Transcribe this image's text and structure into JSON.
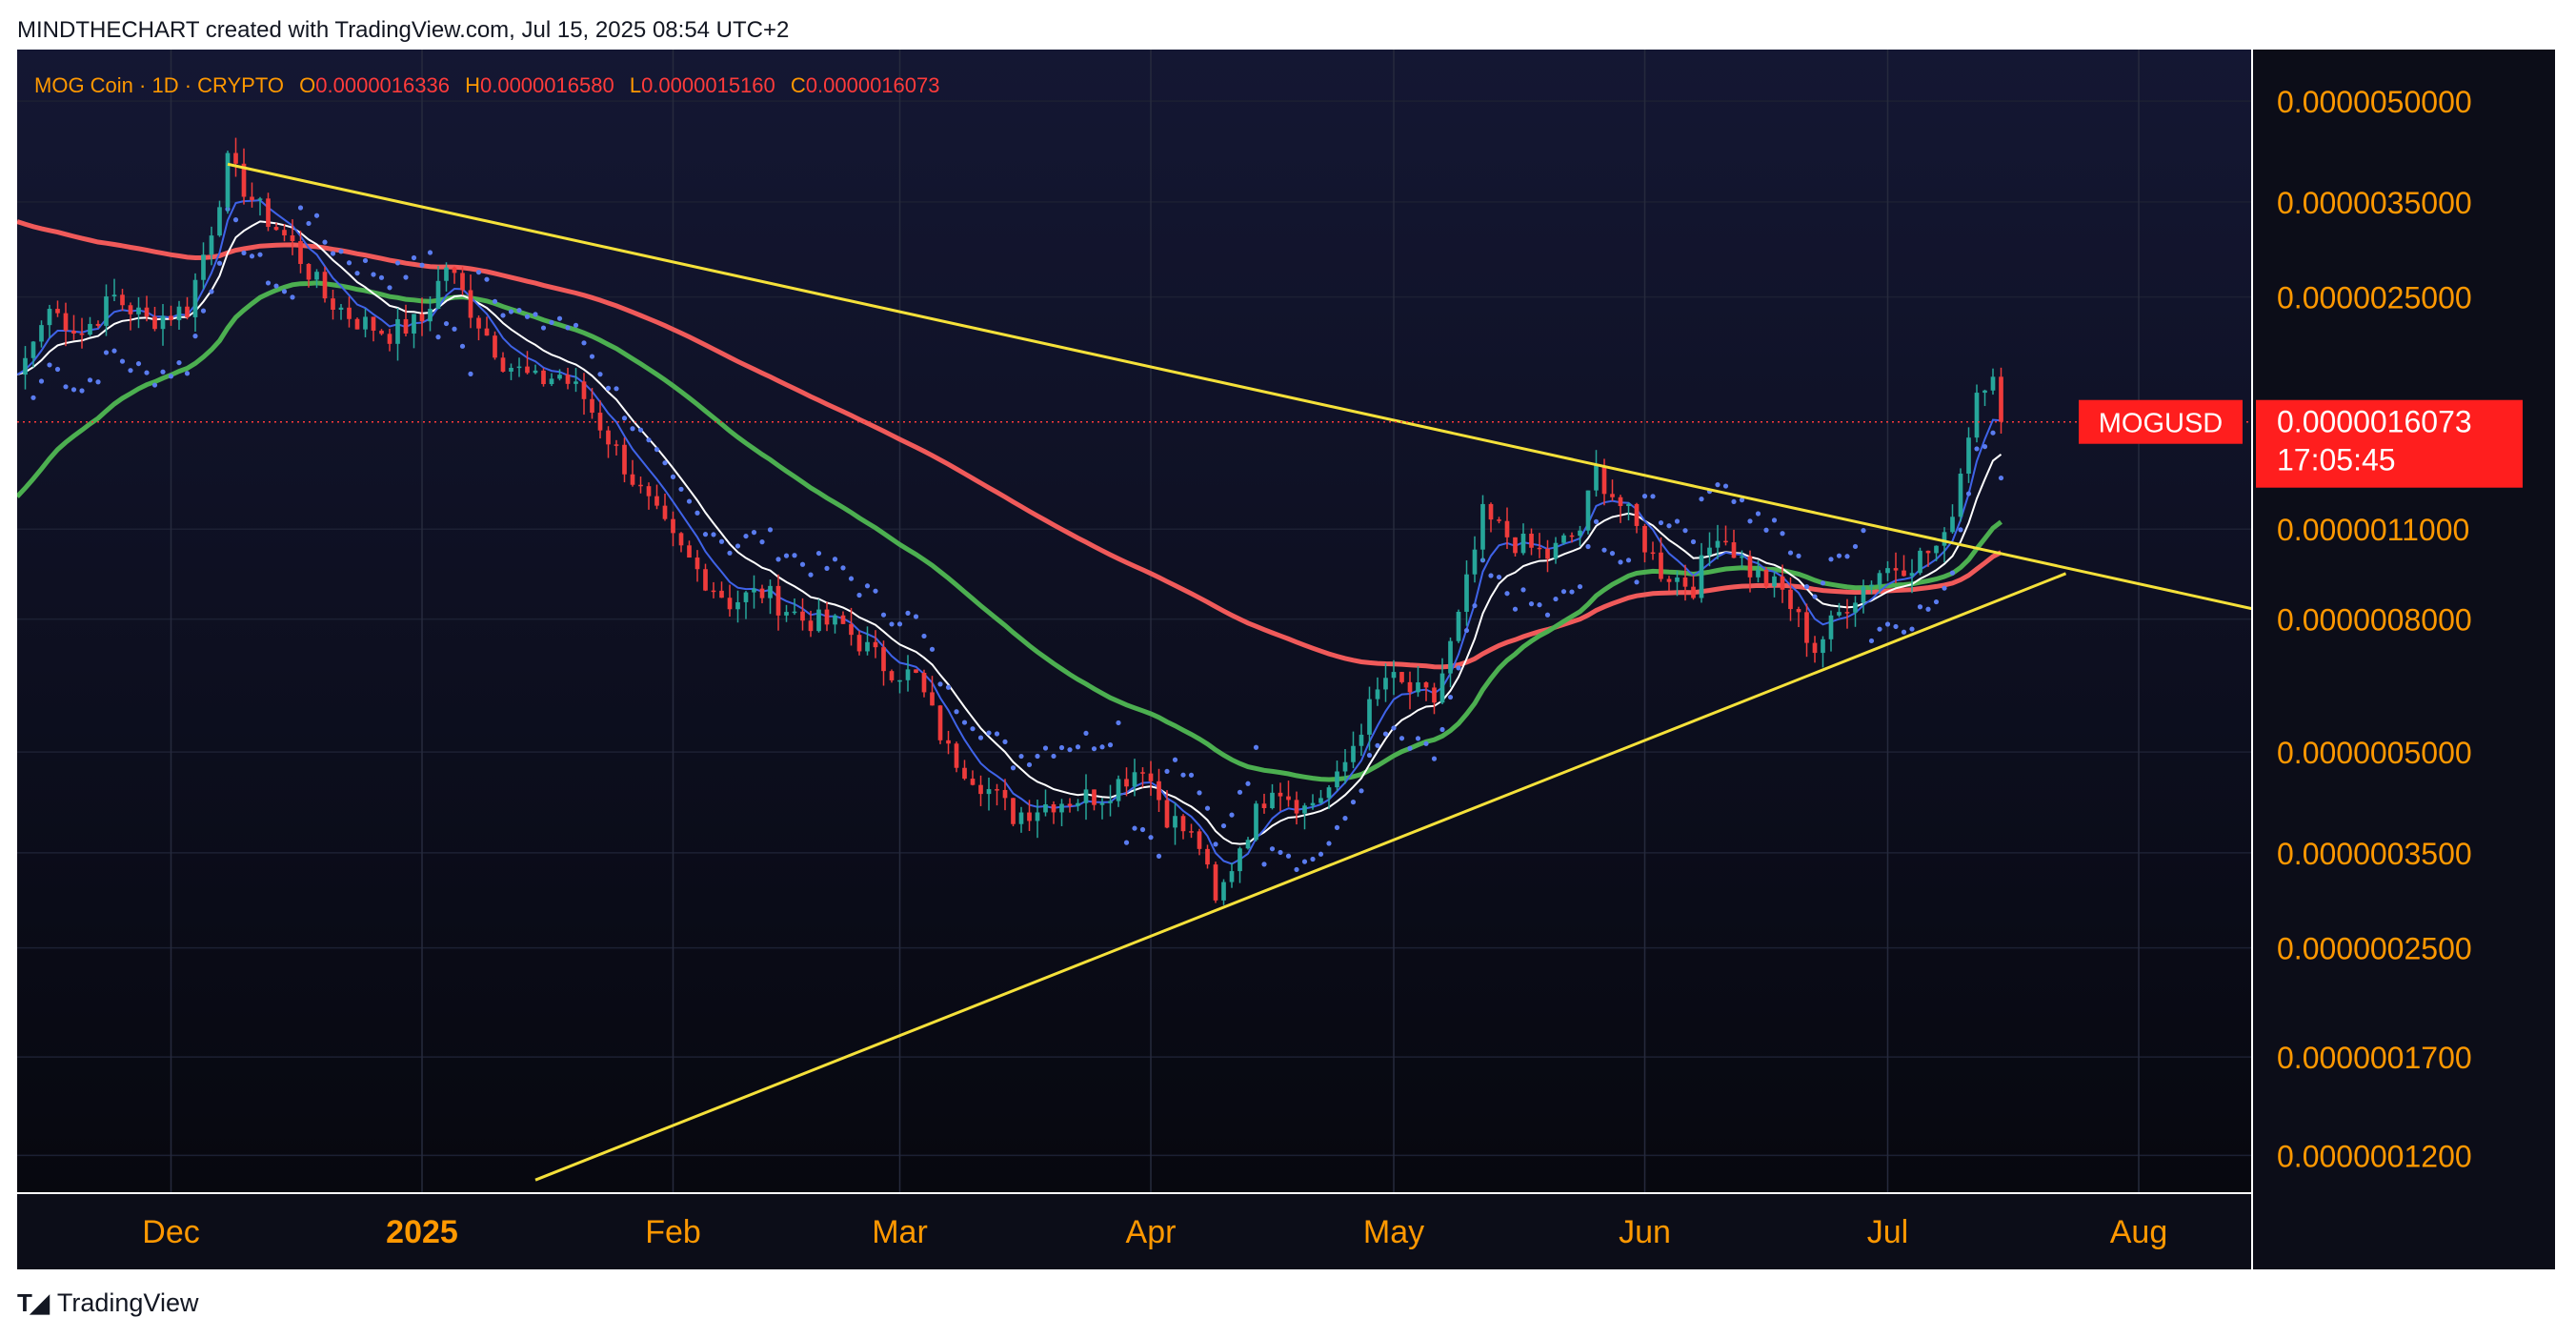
{
  "attribution": "MINDTHECHART created with TradingView.com, Jul 15, 2025 08:54 UTC+2",
  "footer": {
    "logo_text": "TradingView",
    "logo_icon": "tradingview-logo-icon"
  },
  "colors": {
    "background": "#0c0d18",
    "up_candle": "#26a69a",
    "down_candle": "#ef3b3b",
    "ema_long": "#f05a5a",
    "ema_mid": "#4caf50",
    "ma_fast_white": "#ffffff",
    "ma_fast_blue": "#3f63e8",
    "psar_dots": "#5a7cf0",
    "trendline": "#f5e13a",
    "axis_text": "#ff9800",
    "price_label_bg": "#ff1e1e"
  },
  "legend": {
    "symbol": "MOG Coin · 1D · CRYPTO",
    "o_label": "O",
    "o_value": "0.0000016336",
    "h_label": "H",
    "h_value": "0.0000016580",
    "l_label": "L",
    "l_value": "0.0000015160",
    "c_label": "C",
    "c_value": "0.0000016073"
  },
  "price_label": {
    "ticker": "MOGUSD",
    "price": "0.0000016073",
    "countdown": "17:05:45"
  },
  "chart_data": {
    "type": "candlestick",
    "scale": "log",
    "y_ticks": [
      "0.0000050000",
      "0.0000035000",
      "0.0000025000",
      "0.0000011000",
      "0.0000008000",
      "0.0000005000",
      "0.0000003500",
      "0.0000002500",
      "0.0000001700",
      "0.0000001200"
    ],
    "y_tick_values": [
      5e-06,
      3.5e-06,
      2.5e-06,
      1.1e-06,
      8e-07,
      5e-07,
      3.5e-07,
      2.5e-07,
      1.7e-07,
      1.2e-07
    ],
    "x_ticks": [
      "Dec",
      "2025",
      "Feb",
      "Mar",
      "Apr",
      "May",
      "Jun",
      "Jul",
      "Aug"
    ],
    "x_tick_dates": [
      "2024-12-01",
      "2025-01-01",
      "2025-02-01",
      "2025-03-01",
      "2025-04-01",
      "2025-05-01",
      "2025-06-01",
      "2025-07-01",
      "2025-08-01"
    ],
    "x_range": [
      "2024-11-12",
      "2025-08-15"
    ],
    "y_range": [
      1.05e-07,
      6e-06
    ],
    "grid": true,
    "last_close": 1.6073e-06,
    "close_series": [
      {
        "date": "2024-11-12",
        "close": 1.9e-06
      },
      {
        "date": "2024-11-16",
        "close": 2.4e-06
      },
      {
        "date": "2024-11-20",
        "close": 2.2e-06
      },
      {
        "date": "2024-11-24",
        "close": 2.5e-06
      },
      {
        "date": "2024-11-28",
        "close": 2.3e-06
      },
      {
        "date": "2024-12-03",
        "close": 2.4e-06
      },
      {
        "date": "2024-12-06",
        "close": 3.2e-06
      },
      {
        "date": "2024-12-08",
        "close": 4e-06
      },
      {
        "date": "2024-12-12",
        "close": 3.4e-06
      },
      {
        "date": "2024-12-16",
        "close": 3e-06
      },
      {
        "date": "2024-12-20",
        "close": 2.5e-06
      },
      {
        "date": "2024-12-24",
        "close": 2.3e-06
      },
      {
        "date": "2024-12-28",
        "close": 2.2e-06
      },
      {
        "date": "2025-01-01",
        "close": 2.3e-06
      },
      {
        "date": "2025-01-04",
        "close": 2.8e-06
      },
      {
        "date": "2025-01-07",
        "close": 2.4e-06
      },
      {
        "date": "2025-01-11",
        "close": 2e-06
      },
      {
        "date": "2025-01-15",
        "close": 1.85e-06
      },
      {
        "date": "2025-01-18",
        "close": 1.9e-06
      },
      {
        "date": "2025-01-21",
        "close": 1.75e-06
      },
      {
        "date": "2025-01-25",
        "close": 1.45e-06
      },
      {
        "date": "2025-01-28",
        "close": 1.25e-06
      },
      {
        "date": "2025-02-01",
        "close": 1.05e-06
      },
      {
        "date": "2025-02-04",
        "close": 9.5e-07
      },
      {
        "date": "2025-02-08",
        "close": 8.5e-07
      },
      {
        "date": "2025-02-12",
        "close": 8.8e-07
      },
      {
        "date": "2025-02-17",
        "close": 8e-07
      },
      {
        "date": "2025-02-22",
        "close": 7.8e-07
      },
      {
        "date": "2025-02-27",
        "close": 6.8e-07
      },
      {
        "date": "2025-03-03",
        "close": 6.5e-07
      },
      {
        "date": "2025-03-07",
        "close": 5e-07
      },
      {
        "date": "2025-03-11",
        "close": 4.5e-07
      },
      {
        "date": "2025-03-15",
        "close": 4e-07
      },
      {
        "date": "2025-03-20",
        "close": 4.2e-07
      },
      {
        "date": "2025-03-26",
        "close": 4.3e-07
      },
      {
        "date": "2025-03-31",
        "close": 4.8e-07
      },
      {
        "date": "2025-04-03",
        "close": 4e-07
      },
      {
        "date": "2025-04-07",
        "close": 3.6e-07
      },
      {
        "date": "2025-04-09",
        "close": 2.9e-07
      },
      {
        "date": "2025-04-12",
        "close": 3.6e-07
      },
      {
        "date": "2025-04-16",
        "close": 4.5e-07
      },
      {
        "date": "2025-04-20",
        "close": 4.1e-07
      },
      {
        "date": "2025-04-24",
        "close": 4.5e-07
      },
      {
        "date": "2025-04-27",
        "close": 5.5e-07
      },
      {
        "date": "2025-04-30",
        "close": 6.5e-07
      },
      {
        "date": "2025-05-03",
        "close": 6.2e-07
      },
      {
        "date": "2025-05-06",
        "close": 6e-07
      },
      {
        "date": "2025-05-09",
        "close": 8e-07
      },
      {
        "date": "2025-05-12",
        "close": 1.15e-06
      },
      {
        "date": "2025-05-16",
        "close": 1.05e-06
      },
      {
        "date": "2025-05-20",
        "close": 1e-06
      },
      {
        "date": "2025-05-24",
        "close": 1.1e-06
      },
      {
        "date": "2025-05-26",
        "close": 1.35e-06
      },
      {
        "date": "2025-05-30",
        "close": 1.15e-06
      },
      {
        "date": "2025-06-03",
        "close": 9.5e-07
      },
      {
        "date": "2025-06-07",
        "close": 9e-07
      },
      {
        "date": "2025-06-10",
        "close": 1.1e-06
      },
      {
        "date": "2025-06-14",
        "close": 9.5e-07
      },
      {
        "date": "2025-06-18",
        "close": 8.8e-07
      },
      {
        "date": "2025-06-22",
        "close": 7.2e-07
      },
      {
        "date": "2025-06-26",
        "close": 8.5e-07
      },
      {
        "date": "2025-06-30",
        "close": 9.5e-07
      },
      {
        "date": "2025-07-04",
        "close": 9.8e-07
      },
      {
        "date": "2025-07-08",
        "close": 1.05e-06
      },
      {
        "date": "2025-07-10",
        "close": 1.35e-06
      },
      {
        "date": "2025-07-12",
        "close": 1.8e-06
      },
      {
        "date": "2025-07-14",
        "close": 1.95e-06
      },
      {
        "date": "2025-07-15",
        "close": 1.6073e-06
      }
    ],
    "trendlines": [
      {
        "from": {
          "date": "2024-12-08",
          "price": 4e-06
        },
        "to": {
          "date": "2025-08-15",
          "price": 8.3e-07
        }
      },
      {
        "from": {
          "date": "2025-01-15",
          "price": 1.1e-07
        },
        "to": {
          "date": "2025-07-23",
          "price": 9.4e-07
        }
      }
    ]
  }
}
